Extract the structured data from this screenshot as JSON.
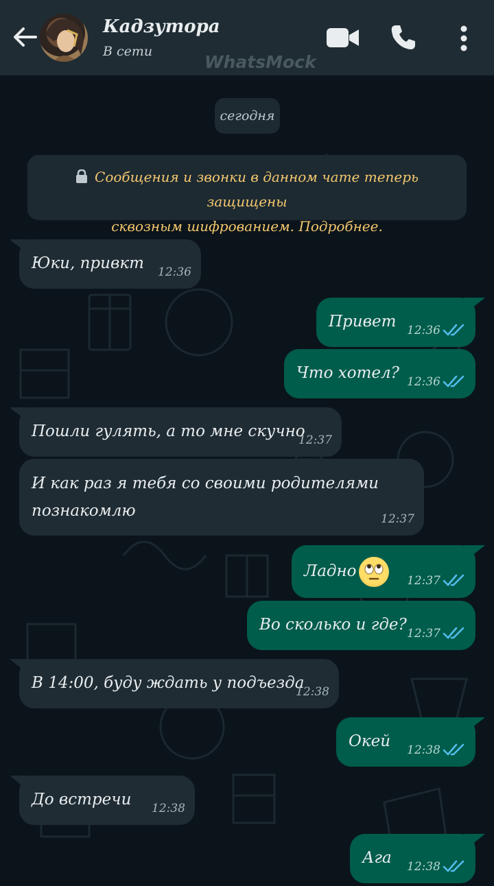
{
  "header": {
    "contact_name": "Кадзутора",
    "status": "В сети",
    "watermark": "WhatsMock",
    "icons": [
      "back-arrow-icon",
      "video-call-icon",
      "phone-icon",
      "more-vert-icon"
    ]
  },
  "chat": {
    "date_label": "сегодня",
    "system_line1": "Сообщения и звонки в данном чате теперь защищены",
    "system_line2": "сквозным шифрованием. Подробнее.",
    "messages": [
      {
        "dir": "in",
        "text": "Юки, привкт",
        "time": "12:36"
      },
      {
        "dir": "out",
        "text": "Привет",
        "time": "12:36",
        "status": "read"
      },
      {
        "dir": "out",
        "text": "Что хотел?",
        "time": "12:36",
        "status": "read"
      },
      {
        "dir": "in",
        "text": "Пошли гулять, а то мне скучно",
        "time": "12:37"
      },
      {
        "dir": "in",
        "text_line1": "И как раз я тебя со своими родителями",
        "text_line2": "познакомлю",
        "time": "12:37"
      },
      {
        "dir": "out",
        "text": "Ладно",
        "emoji": "face-with-rolling-eyes",
        "time": "12:37",
        "status": "read"
      },
      {
        "dir": "out",
        "text": "Во сколько и где?",
        "time": "12:37",
        "status": "read"
      },
      {
        "dir": "in",
        "text": "В 14:00, буду ждать у подъезда",
        "time": "12:38"
      },
      {
        "dir": "out",
        "text": "Окей",
        "time": "12:38",
        "status": "read"
      },
      {
        "dir": "in",
        "text": "До встречи",
        "time": "12:38"
      },
      {
        "dir": "out",
        "text": "Ага",
        "time": "12:38",
        "status": "read"
      }
    ]
  },
  "colors": {
    "background": "#0b141a",
    "header": "#1f2c33",
    "incoming_bubble": "#1f2c33",
    "outgoing_bubble": "#005c4b",
    "read_ticks": "#53bdeb",
    "system_text": "#f5c86e"
  }
}
